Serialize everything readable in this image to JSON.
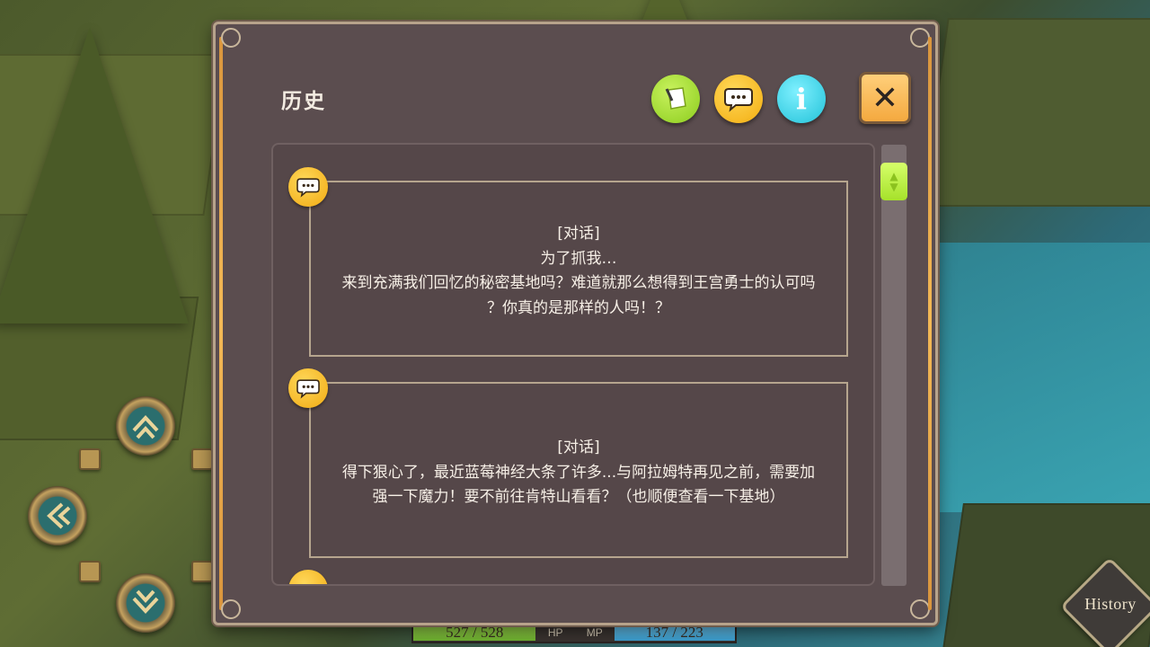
{
  "window": {
    "title": "历史",
    "buttons": {
      "note_icon": "note-icon",
      "talk_icon": "speech-bubble-icon",
      "info_label": "i",
      "close_label": "✕"
    }
  },
  "log": {
    "entries": [
      {
        "tag": "[对话]",
        "lines": [
          "为了抓我…",
          "来到充满我们回忆的秘密基地吗？难道就那么想得到王宫勇士的认可吗",
          "？你真的是那样的人吗！？"
        ]
      },
      {
        "tag": "[对话]",
        "lines": [
          "得下狠心了，最近蓝莓神经大条了许多...与阿拉姆特再见之前，需要加",
          "强一下魔力！要不前往肯特山看看？（也顺便查看一下基地）"
        ]
      }
    ],
    "scroll_position": 0
  },
  "status": {
    "hp_text": "527 / 528",
    "hp_label": "HP",
    "mp_label": "MP",
    "mp_text": "137 / 223",
    "hp_fraction": 0.998,
    "mp_fraction": 0.614
  },
  "history_button": {
    "label": "History"
  },
  "colors": {
    "panel": "#5b4d4f",
    "accent_orange": "#f3b956",
    "hp_green": "#8fce3e",
    "mp_blue": "#4fb2e0",
    "chat_yellow": "#f6c52b"
  }
}
